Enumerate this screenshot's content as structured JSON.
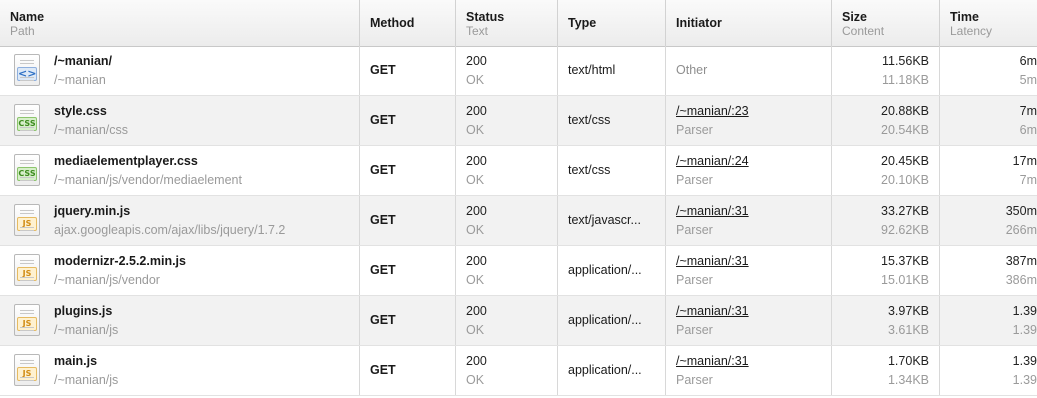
{
  "columns": [
    {
      "title": "Name",
      "subtitle": "Path"
    },
    {
      "title": "Method",
      "subtitle": ""
    },
    {
      "title": "Status",
      "subtitle": "Text"
    },
    {
      "title": "Type",
      "subtitle": ""
    },
    {
      "title": "Initiator",
      "subtitle": ""
    },
    {
      "title": "Size",
      "subtitle": "Content"
    },
    {
      "title": "Time",
      "subtitle": "Latency"
    }
  ],
  "rows": [
    {
      "icon": "html-file-icon",
      "badge": "<>",
      "name": "/~manian/",
      "path": "/~manian",
      "method": "GET",
      "status": "200",
      "status_text": "OK",
      "type": "text/html",
      "initiator": "",
      "initiator_sub": "Other",
      "size": "11.56KB",
      "content": "11.18KB",
      "time": "6m",
      "latency": "5m"
    },
    {
      "icon": "css-file-icon",
      "badge": "CSS",
      "name": "style.css",
      "path": "/~manian/css",
      "method": "GET",
      "status": "200",
      "status_text": "OK",
      "type": "text/css",
      "initiator": "/~manian/:23",
      "initiator_sub": "Parser",
      "size": "20.88KB",
      "content": "20.54KB",
      "time": "7m",
      "latency": "6m"
    },
    {
      "icon": "css-file-icon",
      "badge": "CSS",
      "name": "mediaelementplayer.css",
      "path": "/~manian/js/vendor/mediaelement",
      "method": "GET",
      "status": "200",
      "status_text": "OK",
      "type": "text/css",
      "initiator": "/~manian/:24",
      "initiator_sub": "Parser",
      "size": "20.45KB",
      "content": "20.10KB",
      "time": "17m",
      "latency": "7m"
    },
    {
      "icon": "js-file-icon",
      "badge": "JS",
      "name": "jquery.min.js",
      "path": "ajax.googleapis.com/ajax/libs/jquery/1.7.2",
      "method": "GET",
      "status": "200",
      "status_text": "OK",
      "type": "text/javascr...",
      "initiator": "/~manian/:31",
      "initiator_sub": "Parser",
      "size": "33.27KB",
      "content": "92.62KB",
      "time": "350m",
      "latency": "266m"
    },
    {
      "icon": "js-file-icon",
      "badge": "JS",
      "name": "modernizr-2.5.2.min.js",
      "path": "/~manian/js/vendor",
      "method": "GET",
      "status": "200",
      "status_text": "OK",
      "type": "application/...",
      "initiator": "/~manian/:31",
      "initiator_sub": "Parser",
      "size": "15.37KB",
      "content": "15.01KB",
      "time": "387m",
      "latency": "386m"
    },
    {
      "icon": "js-file-icon",
      "badge": "JS",
      "name": "plugins.js",
      "path": "/~manian/js",
      "method": "GET",
      "status": "200",
      "status_text": "OK",
      "type": "application/...",
      "initiator": "/~manian/:31",
      "initiator_sub": "Parser",
      "size": "3.97KB",
      "content": "3.61KB",
      "time": "1.39",
      "latency": "1.39"
    },
    {
      "icon": "js-file-icon",
      "badge": "JS",
      "name": "main.js",
      "path": "/~manian/js",
      "method": "GET",
      "status": "200",
      "status_text": "OK",
      "type": "application/...",
      "initiator": "/~manian/:31",
      "initiator_sub": "Parser",
      "size": "1.70KB",
      "content": "1.34KB",
      "time": "1.39",
      "latency": "1.39"
    }
  ]
}
